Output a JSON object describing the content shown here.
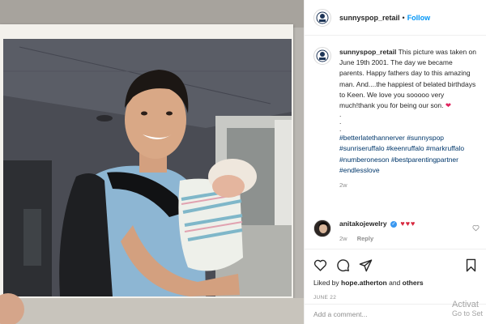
{
  "post": {
    "username": "sunnyspop_retail",
    "follow_label": "Follow",
    "dot": "•"
  },
  "caption": {
    "username": "sunnyspop_retail",
    "text": "This picture was taken on June 19th 2001. The day we became parents. Happy fathers day to this amazing man. And....the happiest of belated birthdays to Keen. We love you sooooo very much!thank you for being our son.",
    "heart": "❤",
    "dots": [
      ".",
      ".",
      "."
    ],
    "hashtags": [
      "#betterlatethannerver",
      "#sunnyspop",
      "#sunriseruffalo",
      "#keenruffalo",
      "#markruffalo",
      "#numberoneson",
      "#bestparentingpartner",
      "#endlesslove"
    ],
    "time": "2w"
  },
  "comment": {
    "username": "anitakojewelry",
    "verified_glyph": "✓",
    "hearts": "♥♥♥",
    "time": "2w",
    "reply_label": "Reply",
    "like_icon": "heart-outline-icon"
  },
  "actions": {
    "icons": [
      "heart-outline-icon",
      "comment-icon",
      "share-icon",
      "save-icon"
    ],
    "liked_prefix": "Liked by",
    "liked_user": "hope.atherton",
    "liked_and": "and",
    "liked_others": "others",
    "date": "JUNE 22"
  },
  "add_comment": {
    "placeholder": "Add a comment..."
  },
  "watermark": {
    "line1": "Activat",
    "line2": "Go to Set"
  },
  "colors": {
    "link": "#0095f6",
    "hashtag": "#00376b",
    "heart": "#d7263d",
    "muted": "#8e8e8e"
  }
}
